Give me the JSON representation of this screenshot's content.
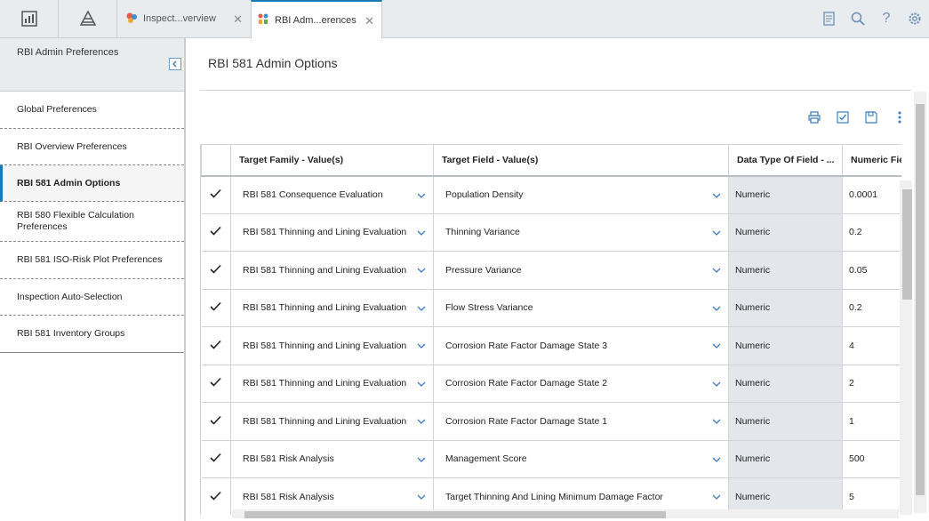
{
  "topbar": {
    "icons": [
      "dashboard-icon",
      "hierarchy-icon"
    ],
    "tabs": [
      {
        "label": "Inspect...verview",
        "icon": "inspection-overview-icon",
        "active": false
      },
      {
        "label": "RBI Adm...erences",
        "icon": "preferences-icon",
        "active": true
      }
    ],
    "close_glyph": "✕",
    "right_icons": [
      "notes-icon",
      "search-icon",
      "help-icon",
      "settings-gear-icon"
    ]
  },
  "sidebar": {
    "title": "RBI Admin Preferences",
    "items": [
      {
        "label": "Global Preferences"
      },
      {
        "label": "RBI Overview Preferences"
      },
      {
        "label": "RBI 581 Admin Options",
        "active": true
      },
      {
        "label": "RBI 580 Flexible Calculation Preferences"
      },
      {
        "label": "RBI 581 ISO-Risk Plot Preferences"
      },
      {
        "label": "Inspection Auto-Selection"
      },
      {
        "label": "RBI 581 Inventory Groups"
      }
    ]
  },
  "main": {
    "title": "RBI 581 Admin Options",
    "toolbar": [
      "print-icon",
      "select-all-icon",
      "save-icon",
      "more-options-icon"
    ],
    "grid": {
      "columns": [
        "",
        "Target Family - Value(s)",
        "Target Field - Value(s)",
        "Data Type Of Field - ...",
        "Numeric Fie"
      ],
      "rows": [
        {
          "family": "RBI 581 Consequence Evaluation",
          "field": "Population Density",
          "type": "Numeric",
          "value": "0.0001"
        },
        {
          "family": "RBI 581 Thinning and Lining Evaluation",
          "field": "Thinning Variance",
          "type": "Numeric",
          "value": "0.2"
        },
        {
          "family": "RBI 581 Thinning and Lining Evaluation",
          "field": "Pressure Variance",
          "type": "Numeric",
          "value": "0.05"
        },
        {
          "family": "RBI 581 Thinning and Lining Evaluation",
          "field": "Flow Stress Variance",
          "type": "Numeric",
          "value": "0.2"
        },
        {
          "family": "RBI 581 Thinning and Lining Evaluation",
          "field": "Corrosion Rate Factor Damage State 3",
          "type": "Numeric",
          "value": "4"
        },
        {
          "family": "RBI 581 Thinning and Lining Evaluation",
          "field": "Corrosion Rate Factor Damage State 2",
          "type": "Numeric",
          "value": "2"
        },
        {
          "family": "RBI 581 Thinning and Lining Evaluation",
          "field": "Corrosion Rate Factor Damage State 1",
          "type": "Numeric",
          "value": "1"
        },
        {
          "family": "RBI 581 Risk Analysis",
          "field": "Management Score",
          "type": "Numeric",
          "value": "500"
        },
        {
          "family": "RBI 581 Risk Analysis",
          "field": "Target Thinning And Lining Minimum Damage Factor",
          "type": "Numeric",
          "value": "5"
        }
      ]
    }
  }
}
